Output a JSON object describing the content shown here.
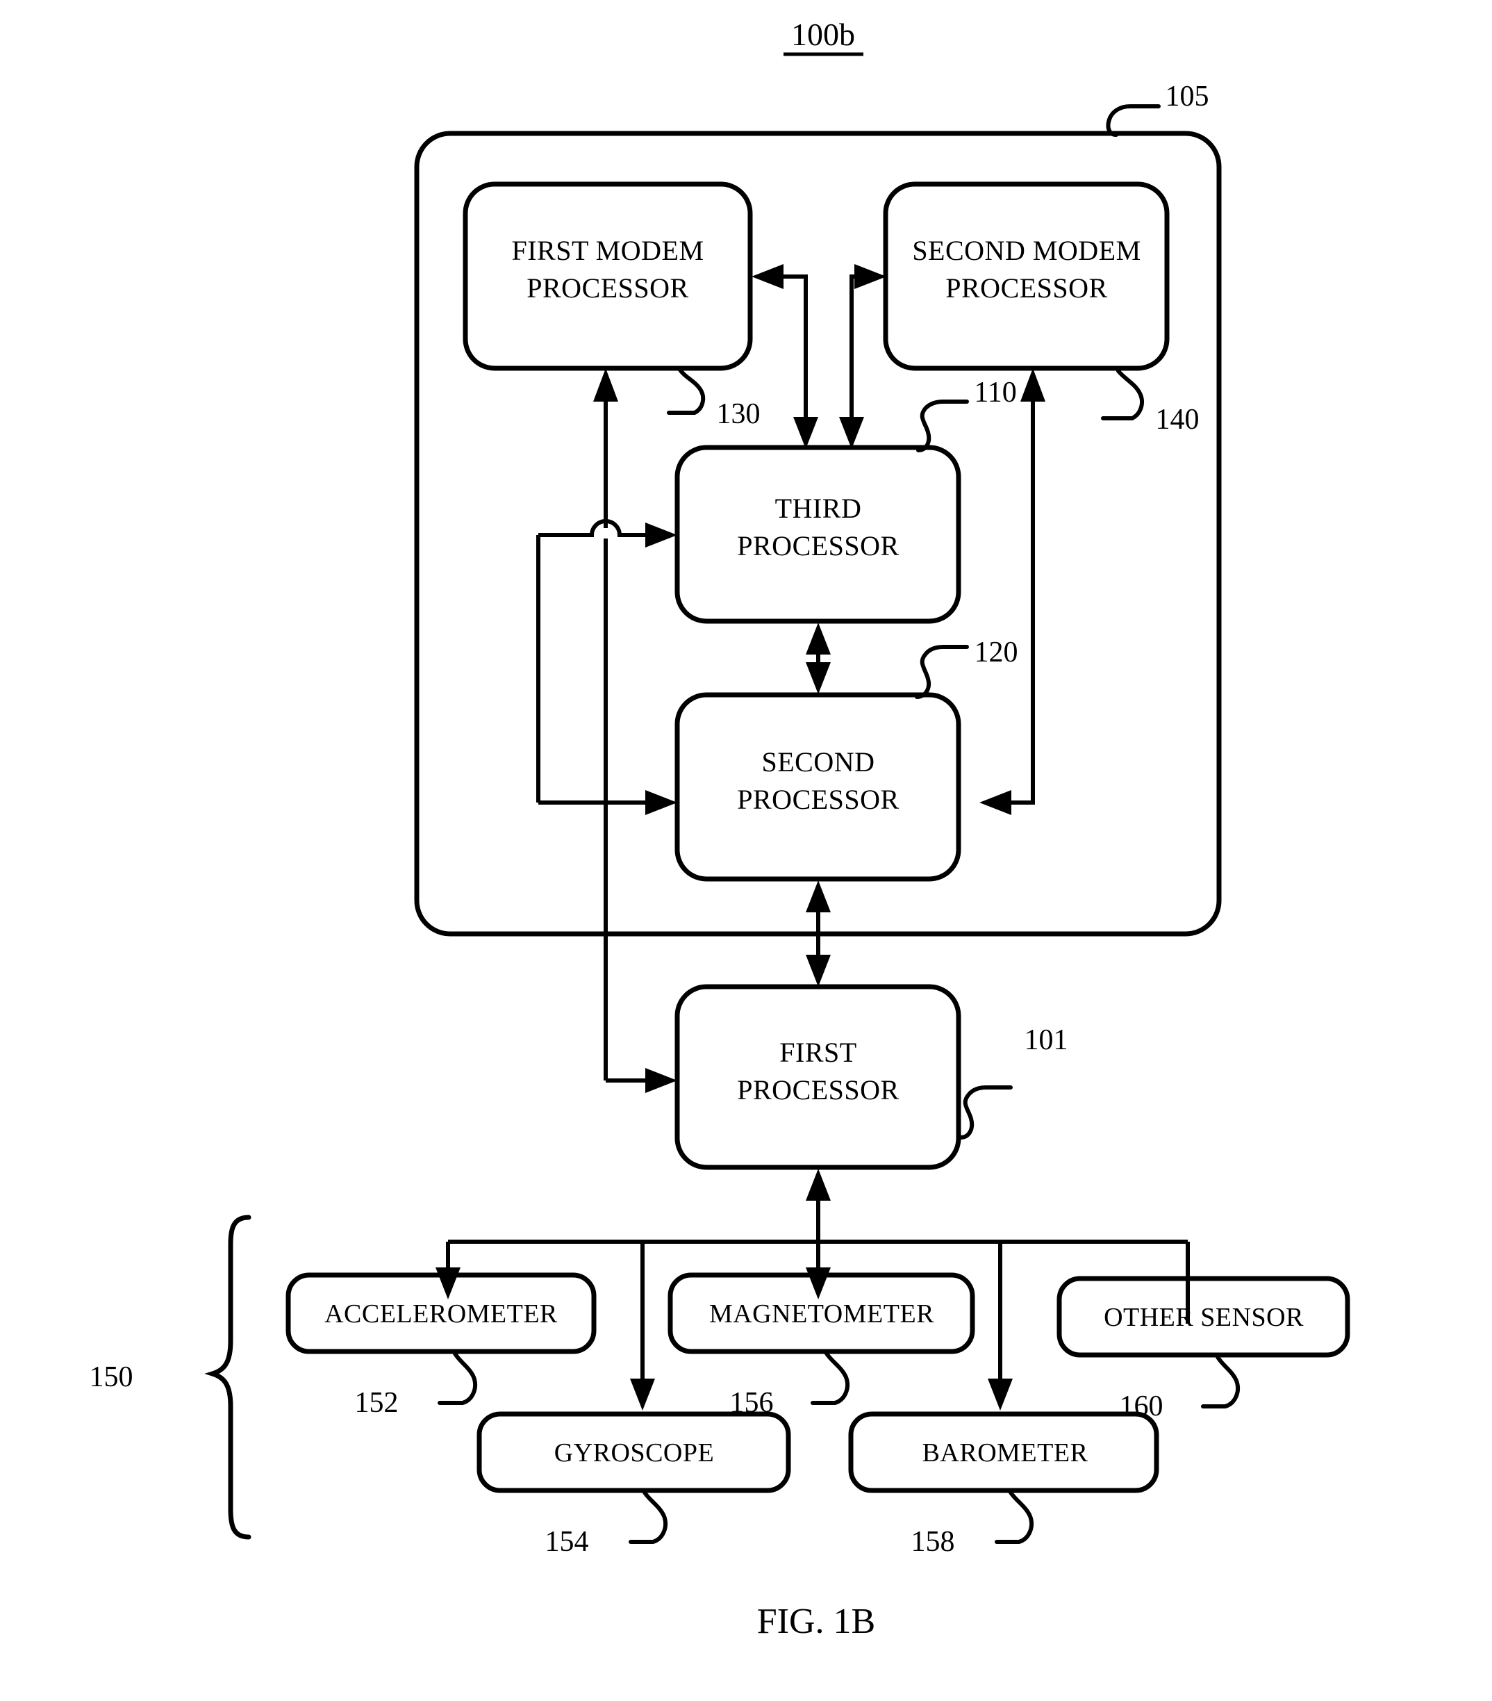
{
  "figure": {
    "title": "100b",
    "caption": "FIG. 1B"
  },
  "container": {
    "ref": "105"
  },
  "boxes": [
    {
      "id": "first-modem-processor",
      "line1": "FIRST MODEM",
      "line2": "PROCESSOR",
      "ref": "130"
    },
    {
      "id": "second-modem-processor",
      "line1": "SECOND MODEM",
      "line2": "PROCESSOR",
      "ref": "140"
    },
    {
      "id": "third-processor",
      "line1": "THIRD",
      "line2": "PROCESSOR",
      "ref": "110"
    },
    {
      "id": "second-processor",
      "line1": "SECOND",
      "line2": "PROCESSOR",
      "ref": "120"
    },
    {
      "id": "first-processor",
      "line1": "FIRST",
      "line2": "PROCESSOR",
      "ref": "101"
    }
  ],
  "sensors": {
    "group_ref": "150",
    "items": [
      {
        "id": "accelerometer",
        "label": "ACCELEROMETER",
        "ref": "152"
      },
      {
        "id": "magnetometer",
        "label": "MAGNETOMETER",
        "ref": "156"
      },
      {
        "id": "other-sensor",
        "label": "OTHER SENSOR",
        "ref": "160"
      },
      {
        "id": "gyroscope",
        "label": "GYROSCOPE",
        "ref": "154"
      },
      {
        "id": "barometer",
        "label": "BAROMETER",
        "ref": "158"
      }
    ]
  },
  "colors": {
    "ink": "#000000",
    "paper": "#ffffff"
  }
}
